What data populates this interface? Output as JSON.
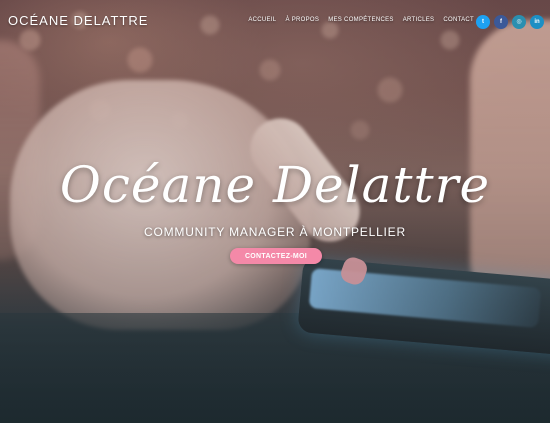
{
  "header": {
    "brand": "OCÉANE DELATTRE",
    "nav": [
      "ACCUEIL",
      "À PROPOS",
      "MES COMPÉTENCES",
      "ARTICLES",
      "CONTACT"
    ]
  },
  "social": [
    {
      "icon": "twitter-icon",
      "glyph": "t",
      "color": "#1da1f2"
    },
    {
      "icon": "facebook-icon",
      "glyph": "f",
      "color": "#3b5998"
    },
    {
      "icon": "instagram-icon",
      "glyph": "◎",
      "color": "#2a8fb0"
    },
    {
      "icon": "linkedin-icon",
      "glyph": "in",
      "color": "#1c8fc4"
    }
  ],
  "hero": {
    "title": "Océane Delattre",
    "subtitle": "COMMUNITY MANAGER À MONTPELLIER",
    "cta": "CONTACTEZ-MOI",
    "cta_color": "#f489a8"
  }
}
